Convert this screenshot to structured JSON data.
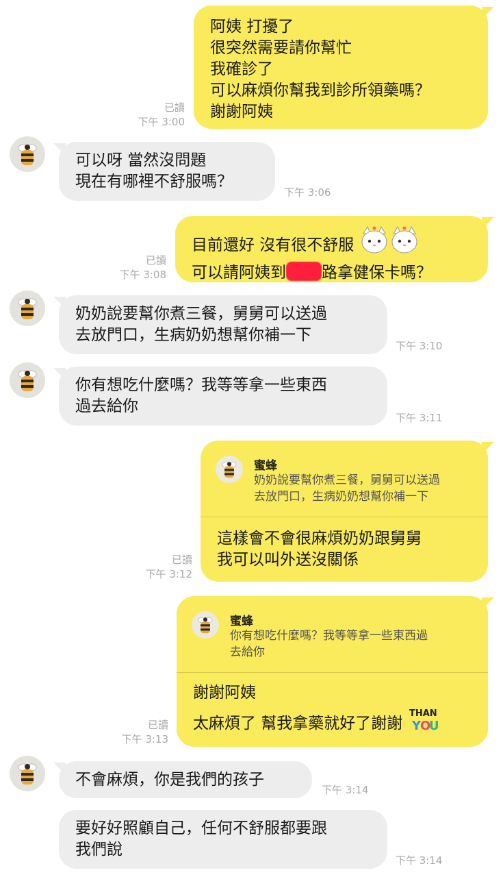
{
  "chat": {
    "contact_name": "蜜蜂",
    "messages": [
      {
        "lines": [
          "阿姨 打擾了",
          "很突然需要請你幫忙",
          "我確診了",
          "可以麻煩你幫我到診所領藥嗎？",
          "謝謝阿姨"
        ],
        "read": "已讀",
        "time": "下午 3:00"
      },
      {
        "lines": [
          "可以呀 當然沒問題",
          "現在有哪裡不舒服嗎？"
        ],
        "time": "下午 3:06"
      },
      {
        "line1": "目前還好 沒有很不舒服",
        "line2_before": "可以請阿姨到",
        "line2_after": "路拿健保卡嗎？",
        "read": "已讀",
        "time": "下午 3:08"
      },
      {
        "lines": [
          "奶奶說要幫你煮三餐，舅舅可以送過",
          "去放門口，生病奶奶想幫你補一下"
        ],
        "time": "下午 3:10"
      },
      {
        "lines": [
          "你有想吃什麼嗎？我等等拿一些東西",
          "過去給你"
        ],
        "time": "下午 3:11"
      },
      {
        "quote_name": "蜜蜂",
        "quote_lines": [
          "奶奶說要幫你煮三餐，舅舅可以送過",
          "去放門口，生病奶奶想幫你補一下"
        ],
        "lines": [
          "這樣會不會很麻煩奶奶跟舅舅",
          "我可以叫外送沒關係"
        ],
        "read": "已讀",
        "time": "下午 3:12"
      },
      {
        "quote_name": "蜜蜂",
        "quote_lines": [
          "你有想吃什麼嗎？我等等拿一些東西過",
          "去給你"
        ],
        "line1": "謝謝阿姨",
        "line2": "太麻煩了 幫我拿藥就好了謝謝",
        "read": "已讀",
        "time": "下午 3:13"
      },
      {
        "lines": [
          "不會麻煩，你是我們的孩子"
        ],
        "time": "下午 3:14"
      },
      {
        "lines": [
          "要好好照顧自己，任何不舒服都要跟",
          "我們說"
        ],
        "time": "下午 3:14"
      }
    ],
    "stickers": {
      "cats": "cats-sticker-icon",
      "thank_you": "thank-you-sticker-icon"
    },
    "colors": {
      "mine": "#faeb5c",
      "theirs": "#ededee",
      "meta": "#a8a8a8"
    }
  }
}
